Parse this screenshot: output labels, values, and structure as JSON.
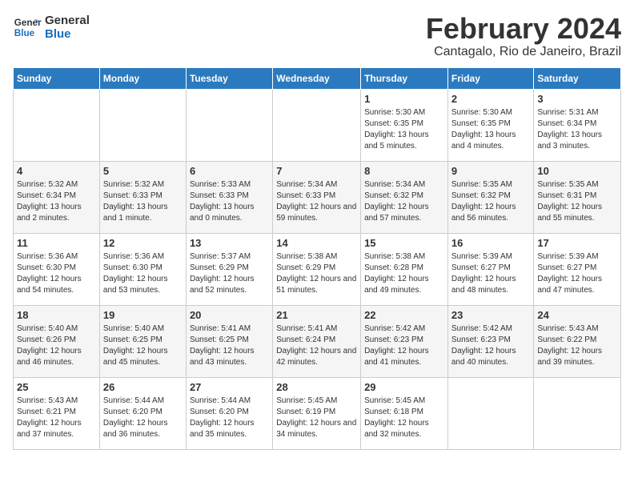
{
  "logo": {
    "line1": "General",
    "line2": "Blue"
  },
  "title": "February 2024",
  "subtitle": "Cantagalo, Rio de Janeiro, Brazil",
  "days_header": [
    "Sunday",
    "Monday",
    "Tuesday",
    "Wednesday",
    "Thursday",
    "Friday",
    "Saturday"
  ],
  "weeks": [
    [
      {
        "day": "",
        "info": ""
      },
      {
        "day": "",
        "info": ""
      },
      {
        "day": "",
        "info": ""
      },
      {
        "day": "",
        "info": ""
      },
      {
        "day": "1",
        "info": "Sunrise: 5:30 AM\nSunset: 6:35 PM\nDaylight: 13 hours and 5 minutes."
      },
      {
        "day": "2",
        "info": "Sunrise: 5:30 AM\nSunset: 6:35 PM\nDaylight: 13 hours and 4 minutes."
      },
      {
        "day": "3",
        "info": "Sunrise: 5:31 AM\nSunset: 6:34 PM\nDaylight: 13 hours and 3 minutes."
      }
    ],
    [
      {
        "day": "4",
        "info": "Sunrise: 5:32 AM\nSunset: 6:34 PM\nDaylight: 13 hours and 2 minutes."
      },
      {
        "day": "5",
        "info": "Sunrise: 5:32 AM\nSunset: 6:33 PM\nDaylight: 13 hours and 1 minute."
      },
      {
        "day": "6",
        "info": "Sunrise: 5:33 AM\nSunset: 6:33 PM\nDaylight: 13 hours and 0 minutes."
      },
      {
        "day": "7",
        "info": "Sunrise: 5:34 AM\nSunset: 6:33 PM\nDaylight: 12 hours and 59 minutes."
      },
      {
        "day": "8",
        "info": "Sunrise: 5:34 AM\nSunset: 6:32 PM\nDaylight: 12 hours and 57 minutes."
      },
      {
        "day": "9",
        "info": "Sunrise: 5:35 AM\nSunset: 6:32 PM\nDaylight: 12 hours and 56 minutes."
      },
      {
        "day": "10",
        "info": "Sunrise: 5:35 AM\nSunset: 6:31 PM\nDaylight: 12 hours and 55 minutes."
      }
    ],
    [
      {
        "day": "11",
        "info": "Sunrise: 5:36 AM\nSunset: 6:30 PM\nDaylight: 12 hours and 54 minutes."
      },
      {
        "day": "12",
        "info": "Sunrise: 5:36 AM\nSunset: 6:30 PM\nDaylight: 12 hours and 53 minutes."
      },
      {
        "day": "13",
        "info": "Sunrise: 5:37 AM\nSunset: 6:29 PM\nDaylight: 12 hours and 52 minutes."
      },
      {
        "day": "14",
        "info": "Sunrise: 5:38 AM\nSunset: 6:29 PM\nDaylight: 12 hours and 51 minutes."
      },
      {
        "day": "15",
        "info": "Sunrise: 5:38 AM\nSunset: 6:28 PM\nDaylight: 12 hours and 49 minutes."
      },
      {
        "day": "16",
        "info": "Sunrise: 5:39 AM\nSunset: 6:27 PM\nDaylight: 12 hours and 48 minutes."
      },
      {
        "day": "17",
        "info": "Sunrise: 5:39 AM\nSunset: 6:27 PM\nDaylight: 12 hours and 47 minutes."
      }
    ],
    [
      {
        "day": "18",
        "info": "Sunrise: 5:40 AM\nSunset: 6:26 PM\nDaylight: 12 hours and 46 minutes."
      },
      {
        "day": "19",
        "info": "Sunrise: 5:40 AM\nSunset: 6:25 PM\nDaylight: 12 hours and 45 minutes."
      },
      {
        "day": "20",
        "info": "Sunrise: 5:41 AM\nSunset: 6:25 PM\nDaylight: 12 hours and 43 minutes."
      },
      {
        "day": "21",
        "info": "Sunrise: 5:41 AM\nSunset: 6:24 PM\nDaylight: 12 hours and 42 minutes."
      },
      {
        "day": "22",
        "info": "Sunrise: 5:42 AM\nSunset: 6:23 PM\nDaylight: 12 hours and 41 minutes."
      },
      {
        "day": "23",
        "info": "Sunrise: 5:42 AM\nSunset: 6:23 PM\nDaylight: 12 hours and 40 minutes."
      },
      {
        "day": "24",
        "info": "Sunrise: 5:43 AM\nSunset: 6:22 PM\nDaylight: 12 hours and 39 minutes."
      }
    ],
    [
      {
        "day": "25",
        "info": "Sunrise: 5:43 AM\nSunset: 6:21 PM\nDaylight: 12 hours and 37 minutes."
      },
      {
        "day": "26",
        "info": "Sunrise: 5:44 AM\nSunset: 6:20 PM\nDaylight: 12 hours and 36 minutes."
      },
      {
        "day": "27",
        "info": "Sunrise: 5:44 AM\nSunset: 6:20 PM\nDaylight: 12 hours and 35 minutes."
      },
      {
        "day": "28",
        "info": "Sunrise: 5:45 AM\nSunset: 6:19 PM\nDaylight: 12 hours and 34 minutes."
      },
      {
        "day": "29",
        "info": "Sunrise: 5:45 AM\nSunset: 6:18 PM\nDaylight: 12 hours and 32 minutes."
      },
      {
        "day": "",
        "info": ""
      },
      {
        "day": "",
        "info": ""
      }
    ]
  ]
}
